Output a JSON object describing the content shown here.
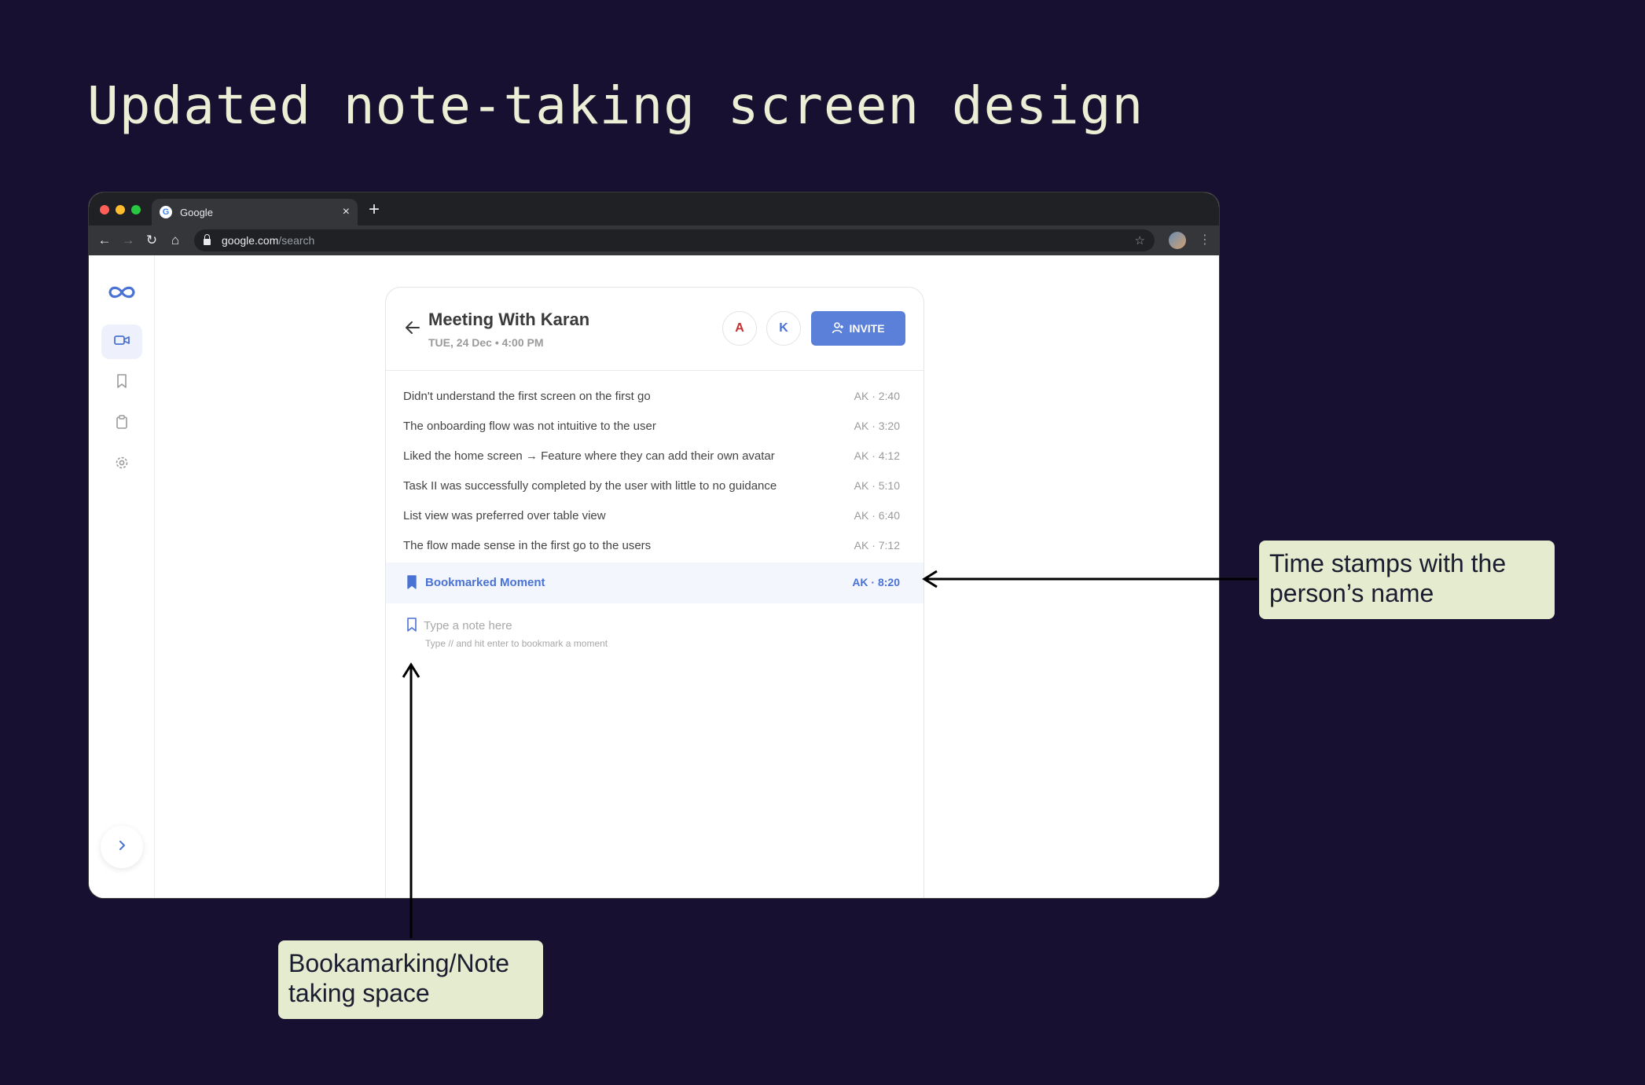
{
  "slide": {
    "title": "Updated note-taking screen design"
  },
  "browser": {
    "tab_title": "Google",
    "tab_close": "×",
    "new_tab": "+",
    "url_host": "google.com",
    "url_path": "/search"
  },
  "meeting": {
    "title": "Meeting With Karan",
    "date": "TUE, 24 Dec • 4:00 PM",
    "participants": [
      "A",
      "K"
    ],
    "invite_label": "INVITE"
  },
  "notes": [
    {
      "text": "Didn't understand the first screen on the first go",
      "stamp": "AK · 2:40"
    },
    {
      "text": "The onboarding flow was not intuitive to the user",
      "stamp": "AK · 3:20"
    },
    {
      "text": "Liked the home screen → Feature where they can add their own avatar",
      "stamp": "AK · 4:12"
    },
    {
      "text": "Task II was successfully completed by the user with little to no guidance",
      "stamp": "AK · 5:10"
    },
    {
      "text": "List view was preferred over table view",
      "stamp": "AK · 6:40"
    },
    {
      "text": "The flow made sense in the first go to the users",
      "stamp": "AK · 7:12"
    }
  ],
  "bookmark": {
    "text": "Bookmarked Moment",
    "stamp": "AK · 8:20"
  },
  "note_input": {
    "placeholder": "Type a note here",
    "hint": "Type // and hit enter to bookmark a moment"
  },
  "annotations": {
    "timestamps": "Time stamps with the person’s name",
    "note_space": "Bookamarking/Note taking space"
  },
  "colors": {
    "background": "#181030",
    "accent": "#5b80d9",
    "callout": "#e4ebce",
    "title": "#ecefd6"
  },
  "icons": [
    "infinity-logo-icon",
    "video-icon",
    "bookmark-icon",
    "clipboard-icon",
    "gear-icon",
    "chevron-right-icon",
    "back-arrow-icon",
    "add-user-icon",
    "star-icon",
    "lock-icon"
  ]
}
